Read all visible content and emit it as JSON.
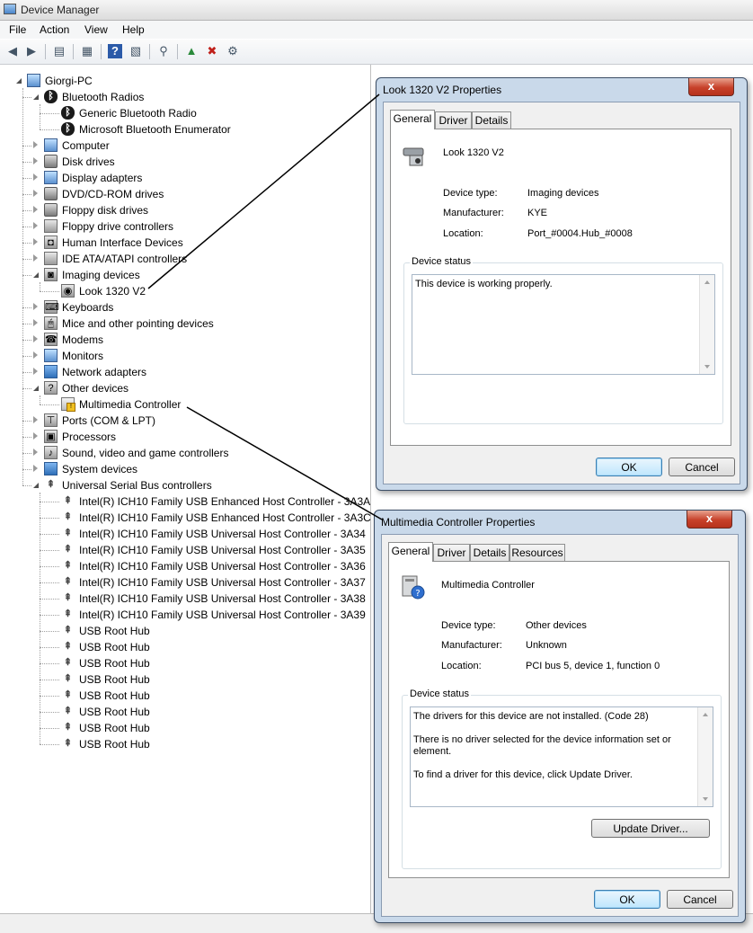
{
  "window": {
    "title": "Device Manager"
  },
  "menu": [
    "File",
    "Action",
    "View",
    "Help"
  ],
  "tree": [
    {
      "label": "Giorgi-PC",
      "level": 0,
      "state": "expanded",
      "icon": "computer-icon"
    },
    {
      "label": "Bluetooth Radios",
      "level": 1,
      "state": "expanded",
      "icon": "bluetooth-icon"
    },
    {
      "label": "Generic Bluetooth Radio",
      "level": 2,
      "state": "leaf",
      "icon": "bluetooth-icon"
    },
    {
      "label": "Microsoft Bluetooth Enumerator",
      "level": 2,
      "state": "leaf",
      "icon": "bluetooth-icon"
    },
    {
      "label": "Computer",
      "level": 1,
      "state": "collapsed",
      "icon": "monitor-icon"
    },
    {
      "label": "Disk drives",
      "level": 1,
      "state": "collapsed",
      "icon": "disk-icon"
    },
    {
      "label": "Display adapters",
      "level": 1,
      "state": "collapsed",
      "icon": "display-adapter-icon"
    },
    {
      "label": "DVD/CD-ROM drives",
      "level": 1,
      "state": "collapsed",
      "icon": "dvd-icon"
    },
    {
      "label": "Floppy disk drives",
      "level": 1,
      "state": "collapsed",
      "icon": "floppy-icon"
    },
    {
      "label": "Floppy drive controllers",
      "level": 1,
      "state": "collapsed",
      "icon": "controller-icon"
    },
    {
      "label": "Human Interface Devices",
      "level": 1,
      "state": "collapsed",
      "icon": "hid-icon"
    },
    {
      "label": "IDE ATA/ATAPI controllers",
      "level": 1,
      "state": "collapsed",
      "icon": "ide-icon"
    },
    {
      "label": "Imaging devices",
      "level": 1,
      "state": "expanded",
      "icon": "camera-icon"
    },
    {
      "label": "Look 1320 V2",
      "level": 2,
      "state": "leaf",
      "icon": "webcam-icon"
    },
    {
      "label": "Keyboards",
      "level": 1,
      "state": "collapsed",
      "icon": "keyboard-icon"
    },
    {
      "label": "Mice and other pointing devices",
      "level": 1,
      "state": "collapsed",
      "icon": "mouse-icon"
    },
    {
      "label": "Modems",
      "level": 1,
      "state": "collapsed",
      "icon": "modem-icon"
    },
    {
      "label": "Monitors",
      "level": 1,
      "state": "collapsed",
      "icon": "monitor-icon"
    },
    {
      "label": "Network adapters",
      "level": 1,
      "state": "collapsed",
      "icon": "network-icon"
    },
    {
      "label": "Other devices",
      "level": 1,
      "state": "expanded",
      "icon": "unknown-device-icon"
    },
    {
      "label": "Multimedia Controller",
      "level": 2,
      "state": "leaf",
      "icon": "warning-device-icon"
    },
    {
      "label": "Ports (COM & LPT)",
      "level": 1,
      "state": "collapsed",
      "icon": "port-icon"
    },
    {
      "label": "Processors",
      "level": 1,
      "state": "collapsed",
      "icon": "processor-icon"
    },
    {
      "label": "Sound, video and game controllers",
      "level": 1,
      "state": "collapsed",
      "icon": "sound-icon"
    },
    {
      "label": "System devices",
      "level": 1,
      "state": "collapsed",
      "icon": "system-icon"
    },
    {
      "label": "Universal Serial Bus controllers",
      "level": 1,
      "state": "expanded",
      "icon": "usb-icon"
    },
    {
      "label": "Intel(R) ICH10 Family USB Enhanced Host Controller - 3A3A",
      "level": 2,
      "state": "leaf",
      "icon": "usb-icon"
    },
    {
      "label": "Intel(R) ICH10 Family USB Enhanced Host Controller - 3A3C",
      "level": 2,
      "state": "leaf",
      "icon": "usb-icon"
    },
    {
      "label": "Intel(R) ICH10 Family USB Universal Host Controller - 3A34",
      "level": 2,
      "state": "leaf",
      "icon": "usb-icon"
    },
    {
      "label": "Intel(R) ICH10 Family USB Universal Host Controller - 3A35",
      "level": 2,
      "state": "leaf",
      "icon": "usb-icon"
    },
    {
      "label": "Intel(R) ICH10 Family USB Universal Host Controller - 3A36",
      "level": 2,
      "state": "leaf",
      "icon": "usb-icon"
    },
    {
      "label": "Intel(R) ICH10 Family USB Universal Host Controller - 3A37",
      "level": 2,
      "state": "leaf",
      "icon": "usb-icon"
    },
    {
      "label": "Intel(R) ICH10 Family USB Universal Host Controller - 3A38",
      "level": 2,
      "state": "leaf",
      "icon": "usb-icon"
    },
    {
      "label": "Intel(R) ICH10 Family USB Universal Host Controller - 3A39",
      "level": 2,
      "state": "leaf",
      "icon": "usb-icon"
    },
    {
      "label": "USB Root Hub",
      "level": 2,
      "state": "leaf",
      "icon": "usb-icon"
    },
    {
      "label": "USB Root Hub",
      "level": 2,
      "state": "leaf",
      "icon": "usb-icon"
    },
    {
      "label": "USB Root Hub",
      "level": 2,
      "state": "leaf",
      "icon": "usb-icon"
    },
    {
      "label": "USB Root Hub",
      "level": 2,
      "state": "leaf",
      "icon": "usb-icon"
    },
    {
      "label": "USB Root Hub",
      "level": 2,
      "state": "leaf",
      "icon": "usb-icon"
    },
    {
      "label": "USB Root Hub",
      "level": 2,
      "state": "leaf",
      "icon": "usb-icon"
    },
    {
      "label": "USB Root Hub",
      "level": 2,
      "state": "leaf",
      "icon": "usb-icon"
    },
    {
      "label": "USB Root Hub",
      "level": 2,
      "state": "leaf",
      "icon": "usb-icon"
    }
  ],
  "dialog1": {
    "title": "Look 1320 V2 Properties",
    "close": "x",
    "tabs": [
      "General",
      "Driver",
      "Details"
    ],
    "device_name": "Look 1320 V2",
    "props": [
      {
        "label": "Device type:",
        "value": "Imaging devices"
      },
      {
        "label": "Manufacturer:",
        "value": "KYE"
      },
      {
        "label": "Location:",
        "value": "Port_#0004.Hub_#0008"
      }
    ],
    "status_label": "Device status",
    "status_text": "This device is working properly.",
    "ok": "OK",
    "cancel": "Cancel"
  },
  "dialog2": {
    "title": "Multimedia Controller Properties",
    "close": "x",
    "tabs": [
      "General",
      "Driver",
      "Details",
      "Resources"
    ],
    "device_name": "Multimedia Controller",
    "props": [
      {
        "label": "Device type:",
        "value": "Other devices"
      },
      {
        "label": "Manufacturer:",
        "value": "Unknown"
      },
      {
        "label": "Location:",
        "value": "PCI bus 5, device 1, function 0"
      }
    ],
    "status_label": "Device status",
    "status_lines": [
      "The drivers for this device are not installed. (Code 28)",
      "There is no driver selected for the device information set or element.",
      "To find a driver for this device, click Update Driver."
    ],
    "update_driver": "Update Driver...",
    "ok": "OK",
    "cancel": "Cancel"
  }
}
